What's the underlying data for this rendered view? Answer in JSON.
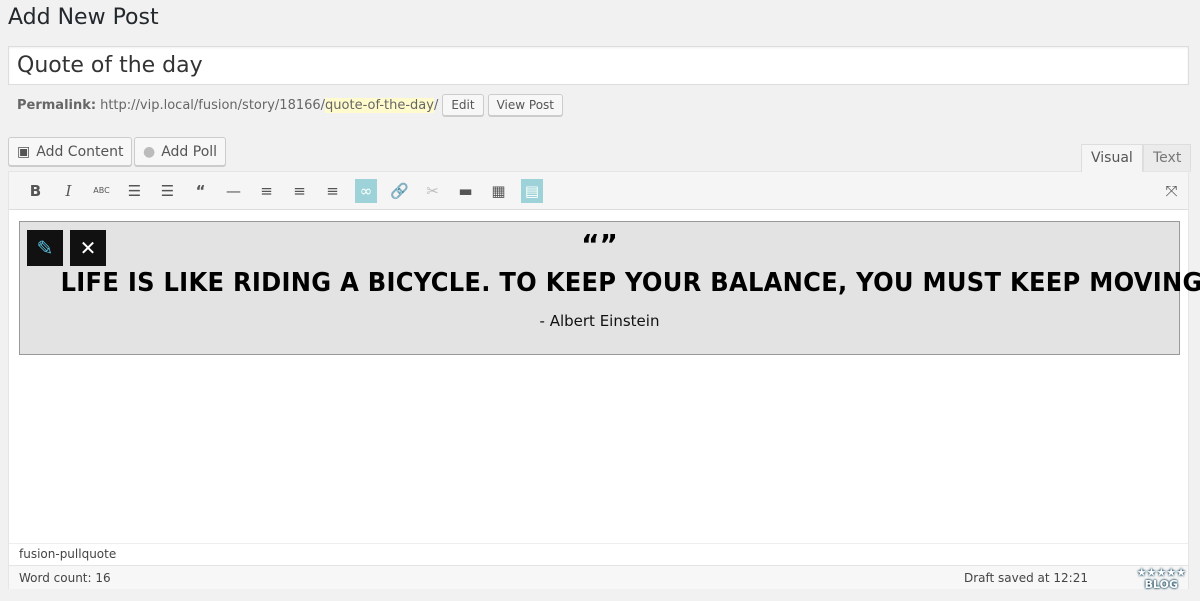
{
  "page_title": "Add New Post",
  "post_title": "Quote of the day",
  "permalink": {
    "label": "Permalink:",
    "base": "http://vip.local/fusion/story/18166/",
    "slug": "quote-of-the-day",
    "trail": "/",
    "edit": "Edit",
    "view": "View Post"
  },
  "media_buttons": {
    "add_content": "Add Content",
    "add_poll": "Add Poll"
  },
  "tabs": {
    "visual": "Visual",
    "text": "Text"
  },
  "toolbar": [
    "bold-icon",
    "italic-icon",
    "strikethrough-icon",
    "bulleted-list-icon",
    "numbered-list-icon",
    "blockquote-icon",
    "horizontal-line-icon",
    "align-left-icon",
    "align-center-icon",
    "align-right-icon",
    "pullquote-icon",
    "link-icon",
    "unlink-icon",
    "read-more-icon",
    "toolbar-toggle-icon",
    "layout-icon",
    "fullscreen-icon"
  ],
  "quote": {
    "marks": "“”",
    "text": "LIFE IS LIKE RIDING A BICYCLE. TO KEEP YOUR BALANCE, YOU MUST KEEP MOVING.",
    "author": "- Albert Einstein"
  },
  "path": "fusion-pullquote",
  "status": {
    "word_count": "Word count: 16",
    "draft": "Draft saved at 12:21"
  },
  "watermark": "BLOG",
  "accent": "#9dd3d8"
}
